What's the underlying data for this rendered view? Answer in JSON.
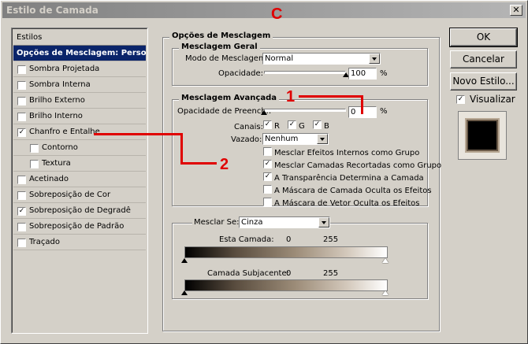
{
  "window": {
    "title": "Estilo de Camada",
    "close_glyph": "✕"
  },
  "styles_panel": {
    "header": "Estilos",
    "items": [
      {
        "label": "Opções de Mesclagem: Personalizadas",
        "selected": true,
        "has_checkbox": false
      },
      {
        "label": "Sombra Projetada",
        "checked": false
      },
      {
        "label": "Sombra Interna",
        "checked": false
      },
      {
        "label": "Brilho Externo",
        "checked": false
      },
      {
        "label": "Brilho Interno",
        "checked": false
      },
      {
        "label": "Chanfro e Entalhe",
        "checked": true
      },
      {
        "label": "Contorno",
        "checked": false,
        "indent": true
      },
      {
        "label": "Textura",
        "checked": false,
        "indent": true
      },
      {
        "label": "Acetinado",
        "checked": false
      },
      {
        "label": "Sobreposição de Cor",
        "checked": false
      },
      {
        "label": "Sobreposição de Degradê",
        "checked": true
      },
      {
        "label": "Sobreposição de Padrão",
        "checked": false
      },
      {
        "label": "Traçado",
        "checked": false
      }
    ]
  },
  "blend_options": {
    "title": "Opções de Mesclagem",
    "general": {
      "title": "Mesclagem Geral",
      "mode_label": "Modo de Mesclagem:",
      "mode_value": "Normal",
      "opacity_label": "Opacidade:",
      "opacity_value": "100",
      "opacity_unit": "%",
      "opacity_fraction": 1.0
    },
    "advanced": {
      "title": "Mesclagem Avançada",
      "fill_opacity_label": "Opacidade de Preench.:",
      "fill_opacity_value": "0",
      "fill_opacity_unit": "%",
      "fill_opacity_fraction": 0.0,
      "channels_label": "Canais:",
      "channels": [
        {
          "label": "R",
          "checked": true
        },
        {
          "label": "G",
          "checked": true
        },
        {
          "label": "B",
          "checked": true
        }
      ],
      "knockout_label": "Vazado:",
      "knockout_value": "Nenhum",
      "options": [
        {
          "label": "Mesclar Efeitos Internos como Grupo",
          "checked": false
        },
        {
          "label": "Mesclar Camadas Recortadas como Grupo",
          "checked": true
        },
        {
          "label": "A Transparência Determina a Camada",
          "checked": true
        },
        {
          "label": "A Máscara de Camada Oculta os Efeitos",
          "checked": false
        },
        {
          "label": "A Máscara de Vetor Oculta os Efeitos",
          "checked": false
        }
      ]
    },
    "blend_if": {
      "label": "Mesclar Se:",
      "value": "Cinza",
      "this_layer_label": "Esta Camada:",
      "this_layer_low": "0",
      "this_layer_high": "255",
      "underlying_label": "Camada Subjacente:",
      "underlying_low": "0",
      "underlying_high": "255"
    }
  },
  "buttons": {
    "ok": "OK",
    "cancel": "Cancelar",
    "new_style": "Novo Estilo...",
    "preview_label": "Visualizar",
    "preview_checked": true
  },
  "annotations": {
    "top": "C",
    "one": "1",
    "two": "2",
    "color": "#e00000"
  },
  "colors": {
    "selection": "#0a246a",
    "dialog_bg": "#d4d0c8"
  }
}
